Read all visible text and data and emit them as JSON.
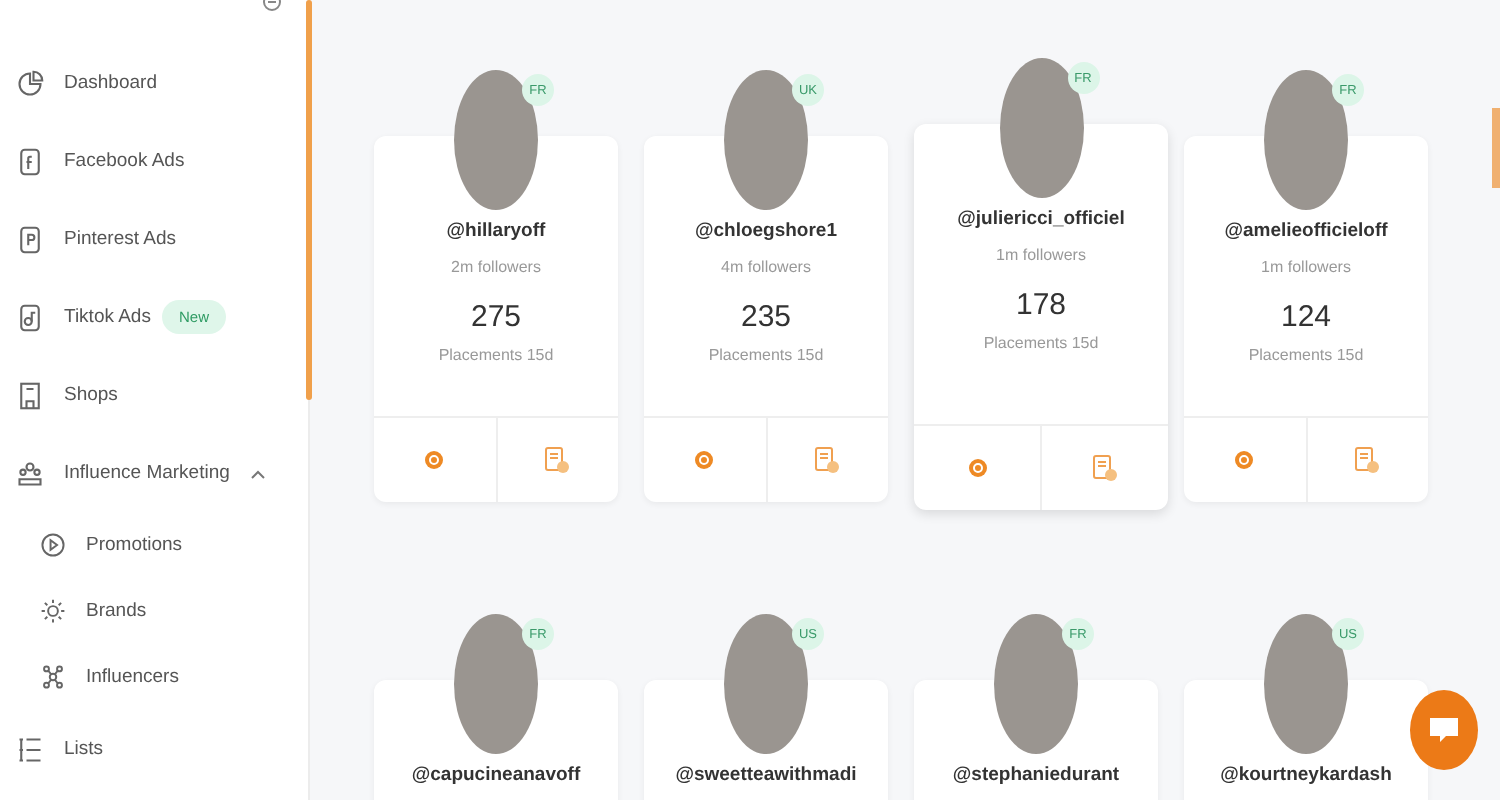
{
  "sidebar": {
    "items": [
      {
        "label": "Dashboard",
        "kind": "item"
      },
      {
        "label": "Facebook Ads",
        "kind": "item"
      },
      {
        "label": "Pinterest Ads",
        "kind": "item"
      },
      {
        "label": "Tiktok Ads",
        "kind": "item",
        "badge": "New"
      },
      {
        "label": "Shops",
        "kind": "item"
      },
      {
        "label": "Influence Marketing",
        "kind": "group",
        "expanded": true,
        "children": [
          {
            "label": "Promotions"
          },
          {
            "label": "Brands"
          },
          {
            "label": "Influencers"
          }
        ]
      },
      {
        "label": "Lists",
        "kind": "item"
      }
    ]
  },
  "influencers": [
    {
      "handle": "@hillaryoff",
      "country": "FR",
      "followers": "2m followers",
      "placements": "275",
      "placements_label": "Placements 15d",
      "highlighted": false
    },
    {
      "handle": "@chloegshore1",
      "country": "UK",
      "followers": "4m followers",
      "placements": "235",
      "placements_label": "Placements 15d",
      "highlighted": false
    },
    {
      "handle": "@juliericci_officiel",
      "country": "FR",
      "followers": "1m followers",
      "placements": "178",
      "placements_label": "Placements 15d",
      "highlighted": true
    },
    {
      "handle": "@amelieofficieloff",
      "country": "FR",
      "followers": "1m followers",
      "placements": "124",
      "placements_label": "Placements 15d",
      "highlighted": false
    },
    {
      "handle": "@capucineanavoff",
      "country": "FR"
    },
    {
      "handle": "@sweetteawithmadi",
      "country": "US"
    },
    {
      "handle": "@stephaniedurant",
      "country": "FR"
    },
    {
      "handle": "@kourtneykardash",
      "country": "US"
    }
  ]
}
